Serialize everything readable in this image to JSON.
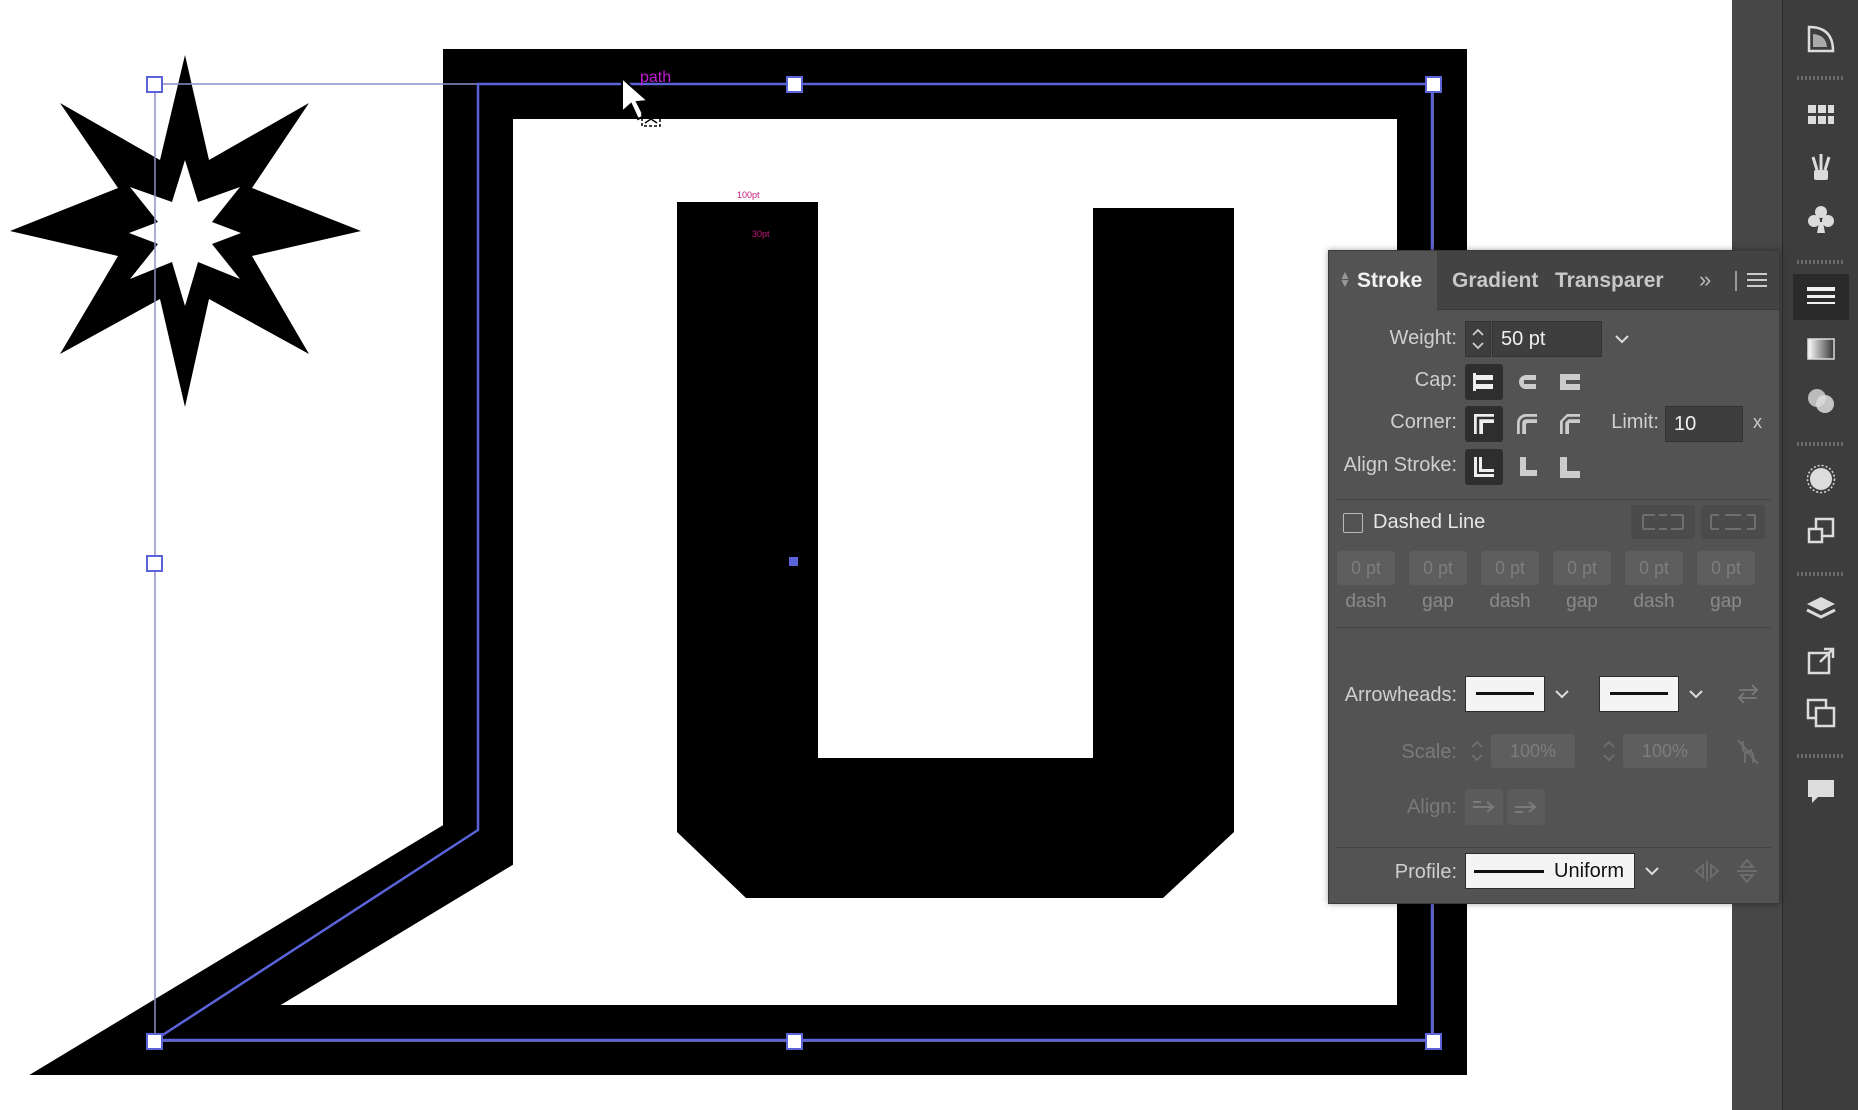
{
  "canvas": {
    "smart_guide_label": "path",
    "measure_label_1": "100pt",
    "measure_label_2": "30pt"
  },
  "stroke_panel": {
    "tabs": [
      "Stroke",
      "Gradient",
      "Transparer"
    ],
    "weight_label": "Weight:",
    "weight_value": "50 pt",
    "cap_label": "Cap:",
    "corner_label": "Corner:",
    "limit_label": "Limit:",
    "limit_value": "10",
    "limit_unit": "x",
    "align_stroke_label": "Align Stroke:",
    "dashed_line_label": "Dashed Line",
    "dashed_line_checked": false,
    "dash_values": [
      "0 pt",
      "0 pt",
      "0 pt",
      "0 pt",
      "0 pt",
      "0 pt"
    ],
    "dash_captions": [
      "dash",
      "gap",
      "dash",
      "gap",
      "dash",
      "gap"
    ],
    "arrowheads_label": "Arrowheads:",
    "scale_label": "Scale:",
    "scale_start": "100%",
    "scale_end": "100%",
    "align_label": "Align:",
    "profile_label": "Profile:",
    "profile_value": "Uniform"
  },
  "colors": {
    "artboard": "#ffffff",
    "path_fill": "#000000",
    "selection": "#5b63d9",
    "smart_guide": "#c41bd6",
    "panel_bg": "#535353"
  }
}
